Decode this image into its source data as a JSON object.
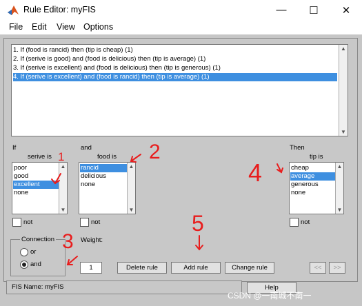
{
  "window": {
    "title": "Rule Editor: myFIS",
    "menus": [
      "File",
      "Edit",
      "View",
      "Options"
    ]
  },
  "rules": [
    {
      "text": "1. If (food is rancid) then (tip is cheap) (1)",
      "selected": false
    },
    {
      "text": "2. If (serive is good) and (food is delicious) then (tip is average) (1)",
      "selected": false
    },
    {
      "text": "3. If (serive is excellent) and (food is delicious) then (tip is generous) (1)",
      "selected": false
    },
    {
      "text": "4. If (serive is excellent) and (food is rancid) then (tip is average) (1)",
      "selected": true
    }
  ],
  "if_section": {
    "label": "If",
    "var_label": "serive is",
    "options": [
      "poor",
      "good",
      "excellent",
      "none"
    ],
    "selected": "excellent",
    "not_label": "not"
  },
  "and_section": {
    "label": "and",
    "var_label": "food is",
    "options": [
      "rancid",
      "delicious",
      "none"
    ],
    "selected": "rancid",
    "not_label": "not"
  },
  "then_section": {
    "label": "Then",
    "var_label": "tip is",
    "options": [
      "cheap",
      "average",
      "generous",
      "none"
    ],
    "selected": "average",
    "not_label": "not"
  },
  "connection": {
    "label": "Connection",
    "options": [
      "or",
      "and"
    ],
    "selected": "and"
  },
  "weight": {
    "label": "Weight:",
    "value": "1"
  },
  "buttons": {
    "delete": "Delete rule",
    "add": "Add rule",
    "change": "Change rule",
    "prev": "<<",
    "next": ">>",
    "help": "Help"
  },
  "status": {
    "fis_name": "FIS Name: myFIS"
  },
  "annotations": [
    "1",
    "2",
    "3",
    "4",
    "5"
  ],
  "watermark": "CSDN @一南城不南一",
  "colors": {
    "selection": "#3e8fe0",
    "annotation": "#e81d1d"
  }
}
